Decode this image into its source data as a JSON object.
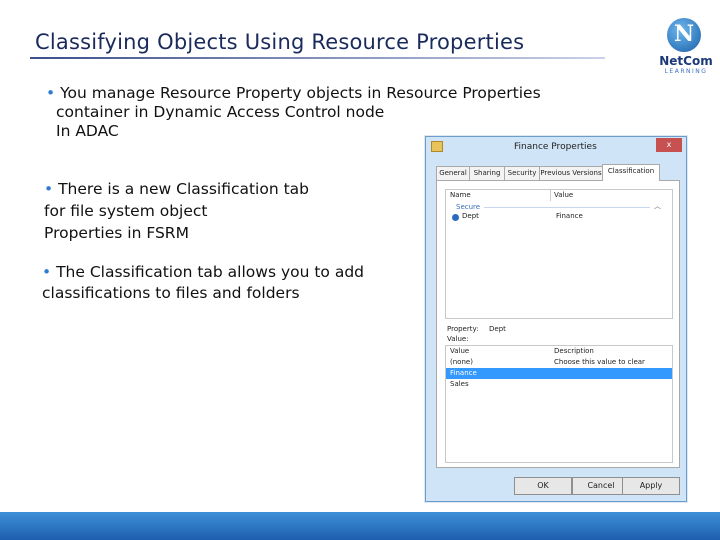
{
  "slide": {
    "title": "Classifying Objects Using Resource Properties",
    "bullets": [
      {
        "lines": [
          "You manage Resource Property objects in Resource Properties",
          "container in Dynamic Access Control node",
          "In ADAC"
        ]
      },
      {
        "lines": [
          "There is a new Classification tab",
          "for file system object",
          "Properties in FSRM"
        ]
      },
      {
        "lines": [
          "The Classification tab allows you to add",
          "classifications to files and folders"
        ]
      }
    ],
    "bullet_glyph": "•"
  },
  "logo": {
    "name": "NetCom",
    "sub": "LEARNING",
    "glyph": "N"
  },
  "dialog": {
    "title": "Finance Properties",
    "close": "x",
    "tabs": [
      "General",
      "Sharing",
      "Security",
      "Previous Versions",
      "Classification"
    ],
    "active_tab": "Classification",
    "list1": {
      "columns": [
        "Name",
        "Value"
      ],
      "group": "Secure",
      "rows": [
        {
          "name": "Dept",
          "value": "Finance"
        }
      ]
    },
    "property_label": "Property:",
    "property_value": "Dept",
    "value_label": "Value:",
    "list2": {
      "columns": [
        "Value",
        "Description"
      ],
      "rows": [
        {
          "value": "(none)",
          "description": "Choose this value to clear"
        },
        {
          "value": "Finance",
          "description": "",
          "selected": true
        },
        {
          "value": "Sales",
          "description": ""
        }
      ]
    },
    "buttons": [
      "OK",
      "Cancel",
      "Apply"
    ]
  },
  "colors": {
    "accent": "#1d5fae",
    "selection": "#3399ff",
    "title": "#1b2a5c"
  }
}
